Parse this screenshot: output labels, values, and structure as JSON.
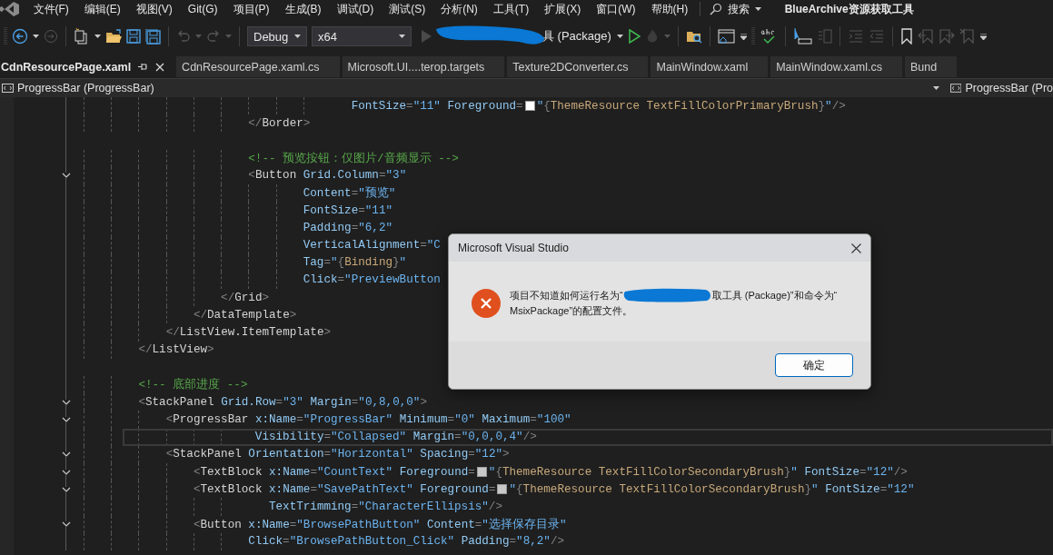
{
  "menu": [
    "文件(F)",
    "编辑(E)",
    "视图(V)",
    "Git(G)",
    "项目(P)",
    "生成(B)",
    "调试(D)",
    "测试(S)",
    "分析(N)",
    "工具(T)",
    "扩展(X)",
    "窗口(W)",
    "帮助(H)"
  ],
  "search": "搜索",
  "title": "BlueArchive资源获取工具",
  "toolbar": {
    "configuration": "Debug",
    "platform": "x64",
    "start": "具 (Package)"
  },
  "tabs": [
    {
      "label": "CdnResourcePage.xaml",
      "selected": true
    },
    {
      "label": "CdnResourcePage.xaml.cs",
      "selected": false
    },
    {
      "label": "Microsoft.UI....terop.targets",
      "selected": false
    },
    {
      "label": "Texture2DConverter.cs",
      "selected": false
    },
    {
      "label": "MainWindow.xaml",
      "selected": false
    },
    {
      "label": "MainWindow.xaml.cs",
      "selected": false
    },
    {
      "label": "Bund",
      "selected": false
    }
  ],
  "navbar": {
    "left": "ProgressBar (ProgressBar)",
    "right": "ProgressBar (Pro"
  },
  "code_lines": [
    {
      "fold": false,
      "current": false,
      "segs": [
        {
          "kind": "code",
          "text": "                                       FontSize=\"11\" Foreground="
        },
        {
          "kind": "swatch",
          "color": "#ffffff"
        },
        {
          "kind": "code",
          "text": "\"{ThemeResource TextFillColorPrimaryBrush}\"/>"
        }
      ]
    },
    {
      "fold": false,
      "current": false,
      "segs": [
        {
          "kind": "code",
          "text": "                        </Border>"
        }
      ]
    },
    {
      "fold": false,
      "current": false
    },
    {
      "fold": false,
      "current": false,
      "segs": [
        {
          "kind": "code",
          "text": "                        <!-- 预览按钮：仅图片/音频显示 -->"
        }
      ]
    },
    {
      "fold": true,
      "current": false,
      "segs": [
        {
          "kind": "code",
          "text": "                        <Button Grid.Column=\"3\""
        }
      ]
    },
    {
      "fold": false,
      "current": false,
      "segs": [
        {
          "kind": "code",
          "text": "                                Content=\"预览\""
        }
      ]
    },
    {
      "fold": false,
      "current": false,
      "segs": [
        {
          "kind": "code",
          "text": "                                FontSize=\"11\""
        }
      ]
    },
    {
      "fold": false,
      "current": false,
      "segs": [
        {
          "kind": "code",
          "text": "                                Padding=\"6,2\""
        }
      ]
    },
    {
      "fold": false,
      "current": false,
      "segs": [
        {
          "kind": "code",
          "text": "                                VerticalAlignment=\"C"
        }
      ]
    },
    {
      "fold": false,
      "current": false,
      "segs": [
        {
          "kind": "code",
          "text": "                                Tag=\"{Binding}\""
        }
      ]
    },
    {
      "fold": false,
      "current": false,
      "segs": [
        {
          "kind": "code",
          "text": "                                Click=\"PreviewButton"
        }
      ]
    },
    {
      "fold": false,
      "current": false,
      "segs": [
        {
          "kind": "code",
          "text": "                    </Grid>"
        }
      ]
    },
    {
      "fold": false,
      "current": false,
      "segs": [
        {
          "kind": "code",
          "text": "                </DataTemplate>"
        }
      ]
    },
    {
      "fold": false,
      "current": false,
      "segs": [
        {
          "kind": "code",
          "text": "            </ListView.ItemTemplate>"
        }
      ]
    },
    {
      "fold": false,
      "current": false,
      "segs": [
        {
          "kind": "code",
          "text": "        </ListView>"
        }
      ]
    },
    {
      "fold": false,
      "current": false
    },
    {
      "fold": false,
      "current": false,
      "segs": [
        {
          "kind": "code",
          "text": "        <!-- 底部进度 -->"
        }
      ]
    },
    {
      "fold": true,
      "current": false,
      "segs": [
        {
          "kind": "code",
          "text": "        <StackPanel Grid.Row=\"3\" Margin=\"0,8,0,0\">"
        }
      ]
    },
    {
      "fold": true,
      "current": false,
      "segs": [
        {
          "kind": "code",
          "text": "            <ProgressBar x:Name=\"ProgressBar\" Minimum=\"0\" Maximum=\"100\""
        }
      ]
    },
    {
      "fold": false,
      "current": true,
      "segs": [
        {
          "kind": "code",
          "text": "                         Visibility=\"Collapsed\" Margin=\"0,0,0,4\"/>"
        }
      ]
    },
    {
      "fold": true,
      "current": false,
      "segs": [
        {
          "kind": "code",
          "text": "            <StackPanel Orientation=\"Horizontal\" Spacing=\"12\">"
        }
      ]
    },
    {
      "fold": true,
      "current": false,
      "segs": [
        {
          "kind": "code",
          "text": "                <TextBlock x:Name=\"CountText\" Foreground="
        },
        {
          "kind": "swatch",
          "color": "#c8c8c8"
        },
        {
          "kind": "code",
          "text": "\"{ThemeResource TextFillColorSecondaryBrush}\" FontSize=\"12\"/>"
        }
      ]
    },
    {
      "fold": true,
      "current": false,
      "segs": [
        {
          "kind": "code",
          "text": "                <TextBlock x:Name=\"SavePathText\" Foreground="
        },
        {
          "kind": "swatch",
          "color": "#c8c8c8"
        },
        {
          "kind": "code",
          "text": "\"{ThemeResource TextFillColorSecondaryBrush}\" FontSize=\"12\""
        }
      ]
    },
    {
      "fold": false,
      "current": false,
      "segs": [
        {
          "kind": "code",
          "text": "                           TextTrimming=\"CharacterEllipsis\"/>"
        }
      ]
    },
    {
      "fold": true,
      "current": false,
      "segs": [
        {
          "kind": "code",
          "text": "                <Button x:Name=\"BrowsePathButton\" Content=\"选择保存目录\""
        }
      ]
    },
    {
      "fold": false,
      "current": false,
      "segs": [
        {
          "kind": "code",
          "text": "                        Click=\"BrowsePathButton_Click\" Padding=\"8,2\"/>"
        }
      ]
    }
  ],
  "dialog": {
    "title": "Microsoft Visual Studio",
    "message": [
      "项目不知道如何运行名为“",
      "取工具 (Package)”和命令为“",
      "MsixPackage”的配置文件。"
    ],
    "button": "确定"
  }
}
